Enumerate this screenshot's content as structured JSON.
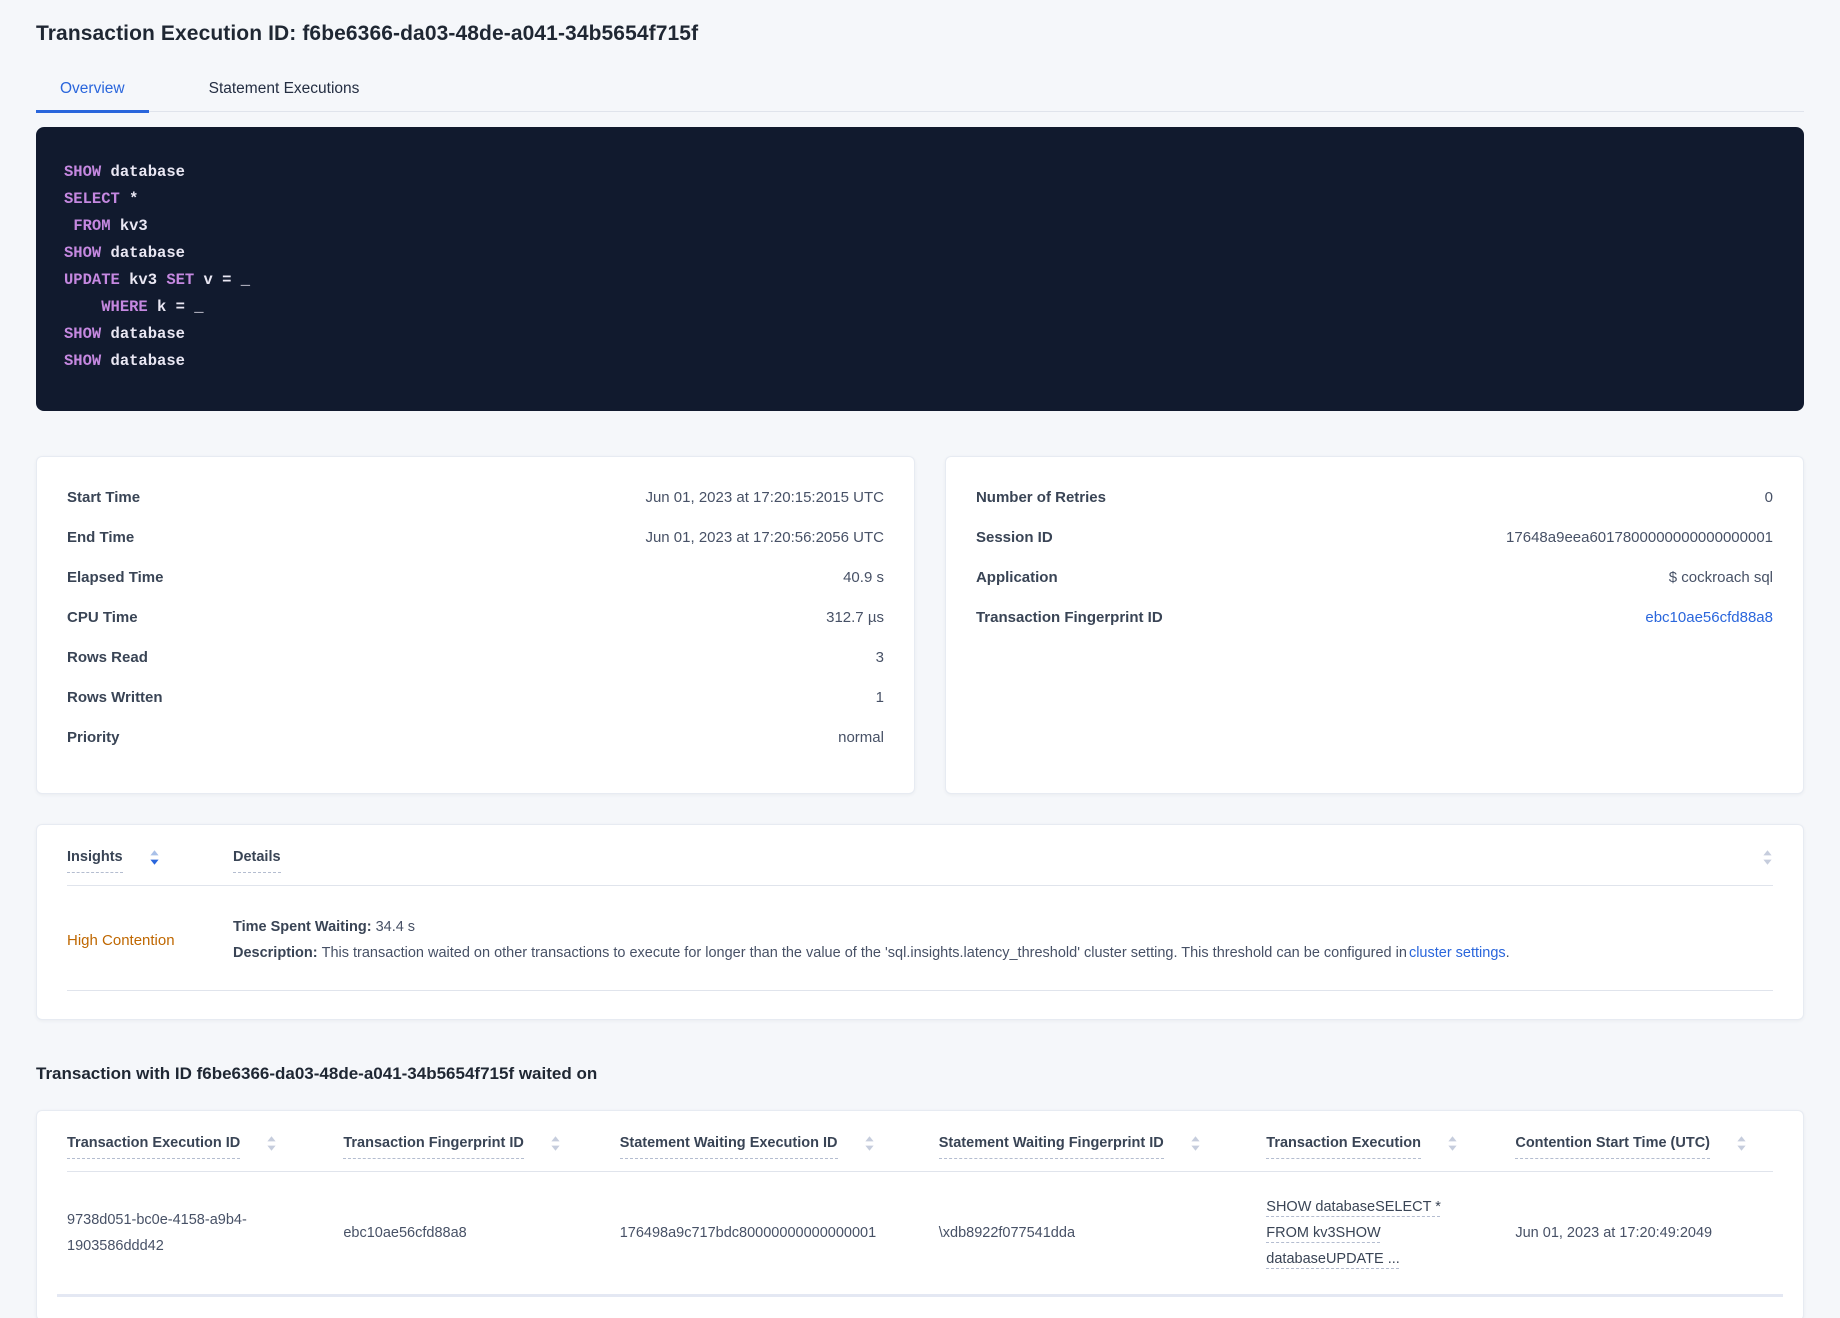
{
  "title": "Transaction Execution ID: f6be6366-da03-48de-a041-34b5654f715f",
  "tabs": {
    "overview": "Overview",
    "statement_executions": "Statement Executions"
  },
  "sql_box": {
    "lines": [
      [
        {
          "t": "SHOW",
          "k": true
        },
        {
          "t": " database",
          "k": false
        }
      ],
      [
        {
          "t": "SELECT",
          "k": true
        },
        {
          "t": " *",
          "k": false
        }
      ],
      [
        {
          "t": " ",
          "k": false
        },
        {
          "t": "FROM",
          "k": true
        },
        {
          "t": " kv3",
          "k": false
        }
      ],
      [
        {
          "t": "SHOW",
          "k": true
        },
        {
          "t": " database",
          "k": false
        }
      ],
      [
        {
          "t": "UPDATE",
          "k": true
        },
        {
          "t": " kv3 ",
          "k": false
        },
        {
          "t": "SET",
          "k": true
        },
        {
          "t": " v = _",
          "k": false
        }
      ],
      [
        {
          "t": "    ",
          "k": false
        },
        {
          "t": "WHERE",
          "k": true
        },
        {
          "t": " k = _",
          "k": false
        }
      ],
      [
        {
          "t": "SHOW",
          "k": true
        },
        {
          "t": " database",
          "k": false
        }
      ],
      [
        {
          "t": "SHOW",
          "k": true
        },
        {
          "t": " database",
          "k": false
        }
      ]
    ]
  },
  "summary_left": {
    "rows": [
      {
        "label": "Start Time",
        "value": "Jun 01, 2023 at 17:20:15:2015 UTC"
      },
      {
        "label": "End Time",
        "value": "Jun 01, 2023 at 17:20:56:2056 UTC"
      },
      {
        "label": "Elapsed Time",
        "value": "40.9 s"
      },
      {
        "label": "CPU Time",
        "value": "312.7 µs"
      },
      {
        "label": "Rows Read",
        "value": "3"
      },
      {
        "label": "Rows Written",
        "value": "1"
      },
      {
        "label": "Priority",
        "value": "normal"
      }
    ]
  },
  "summary_right": {
    "rows": [
      {
        "label": "Number of Retries",
        "value": "0"
      },
      {
        "label": "Session ID",
        "value": "17648a9eea6017800000000000000001"
      },
      {
        "label": "Application",
        "value": "$ cockroach sql"
      },
      {
        "label": "Transaction Fingerprint ID",
        "value": "ebc10ae56cfd88a8",
        "link": true
      }
    ]
  },
  "insights_table": {
    "headers": {
      "insights": "Insights",
      "details": "Details"
    },
    "sort": {
      "active_column": "Insights",
      "direction": "desc"
    },
    "row": {
      "insight_label": "High Contention",
      "waiting_label": "Time Spent Waiting:",
      "waiting_value": "34.4 s",
      "description_label": "Description:",
      "description_text": "This transaction waited on other transactions to execute for longer than the value of the 'sql.insights.latency_threshold' cluster setting. This threshold can be configured in",
      "description_link": "cluster settings",
      "description_suffix": "."
    }
  },
  "waited_on": {
    "heading": "Transaction with ID f6be6366-da03-48de-a041-34b5654f715f waited on",
    "columns": [
      "Transaction Execution ID",
      "Transaction Fingerprint ID",
      "Statement Waiting Execution ID",
      "Statement Waiting Fingerprint ID",
      "Transaction Execution",
      "Contention Start Time (UTC)"
    ],
    "row": {
      "transaction_execution_id": "9738d051-bc0e-4158-a9b4-1903586ddd42",
      "transaction_fingerprint_id": "ebc10ae56cfd88a8",
      "statement_waiting_execution_id": "176498a9c717bdc80000000000000001",
      "statement_waiting_fingerprint_id": "\\xdb8922f077541dda",
      "transaction_execution": "SHOW databaseSELECT * FROM kv3SHOW databaseUPDATE ...",
      "contention_start_time": "Jun 01, 2023 at 17:20:49:2049"
    }
  },
  "colors": {
    "accent_blue": "#2a66dc",
    "warning_orange": "#bf6700",
    "code_keyword": "#c588e0",
    "code_text": "#e9e7f3",
    "code_background": "#111a2e",
    "page_background": "#f5f7fa"
  }
}
